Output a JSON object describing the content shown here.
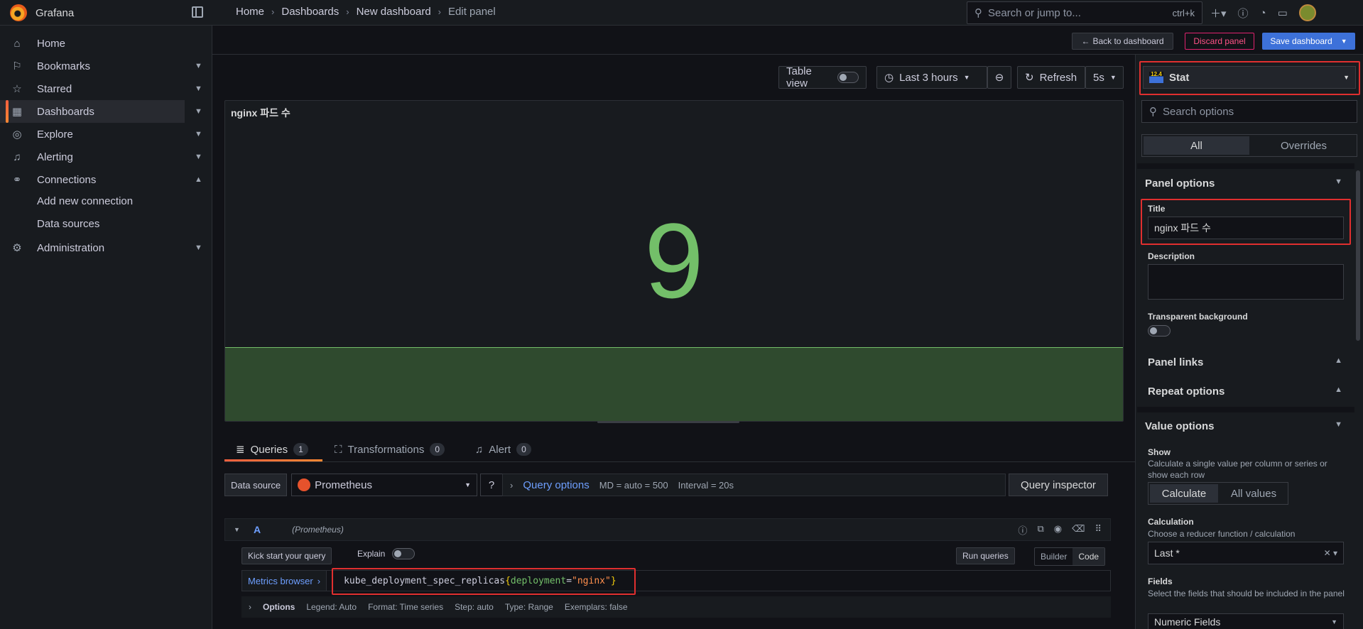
{
  "app": {
    "name": "Grafana"
  },
  "breadcrumbs": [
    "Home",
    "Dashboards",
    "New dashboard",
    "Edit panel"
  ],
  "search": {
    "placeholder": "Search or jump to...",
    "shortcut": "ctrl+k"
  },
  "sidebar": {
    "items": [
      {
        "label": "Home",
        "icon": "home-icon"
      },
      {
        "label": "Bookmarks",
        "icon": "bookmark-icon"
      },
      {
        "label": "Starred",
        "icon": "star-icon"
      },
      {
        "label": "Dashboards",
        "icon": "apps-icon",
        "active": true
      },
      {
        "label": "Explore",
        "icon": "compass-icon"
      },
      {
        "label": "Alerting",
        "icon": "bell-icon"
      },
      {
        "label": "Connections",
        "icon": "link-icon",
        "expanded": true
      },
      {
        "label": "Administration",
        "icon": "cog-icon"
      }
    ],
    "subitems": [
      "Add new connection",
      "Data sources"
    ]
  },
  "actions": {
    "back": "Back to dashboard",
    "discard": "Discard panel",
    "save": "Save dashboard"
  },
  "panel_toolbar": {
    "table_view": "Table view",
    "time_range": "Last 3 hours",
    "refresh": "Refresh",
    "interval": "5s"
  },
  "panel": {
    "title": "nginx 파드 수",
    "value": "9",
    "value_color": "#73bf69"
  },
  "query_tabs": [
    {
      "label": "Queries",
      "count": "1"
    },
    {
      "label": "Transformations",
      "count": "0"
    },
    {
      "label": "Alert",
      "count": "0"
    }
  ],
  "datasource": {
    "label": "Data source",
    "name": "Prometheus",
    "query_options": "Query options",
    "md": "MD = auto = 500",
    "interval": "Interval = 20s",
    "inspector": "Query inspector"
  },
  "query": {
    "ref": "A",
    "datasource": "(Prometheus)",
    "kick_start": "Kick start your query",
    "explain": "Explain",
    "run": "Run queries",
    "mode_builder": "Builder",
    "mode_code": "Code",
    "metrics_browser": "Metrics browser",
    "metric": "kube_deployment_spec_replicas",
    "label_key": "deployment",
    "label_value": "\"nginx\"",
    "options_label": "Options",
    "legend": "Legend: Auto",
    "format": "Format: Time series",
    "step": "Step: auto",
    "type": "Type: Range",
    "exemplars": "Exemplars: false"
  },
  "options_pane": {
    "visualization": "Stat",
    "search_placeholder": "Search options",
    "tab_all": "All",
    "tab_overrides": "Overrides",
    "panel_options": "Panel options",
    "title_label": "Title",
    "title_value": "nginx 파드 수",
    "description_label": "Description",
    "transparent_label": "Transparent background",
    "panel_links": "Panel links",
    "repeat_options": "Repeat options",
    "value_options": "Value options",
    "show_label": "Show",
    "show_desc": "Calculate a single value per column or series or show each row",
    "show_calculate": "Calculate",
    "show_all": "All values",
    "calculation_label": "Calculation",
    "calculation_desc": "Choose a reducer function / calculation",
    "calculation_value": "Last *",
    "fields_label": "Fields",
    "fields_desc": "Select the fields that should be included in the panel",
    "fields_value": "Numeric Fields"
  },
  "colors": {
    "accent": "#3d71d9",
    "danger": "#e02f2f",
    "stat_green": "#73bf69"
  }
}
